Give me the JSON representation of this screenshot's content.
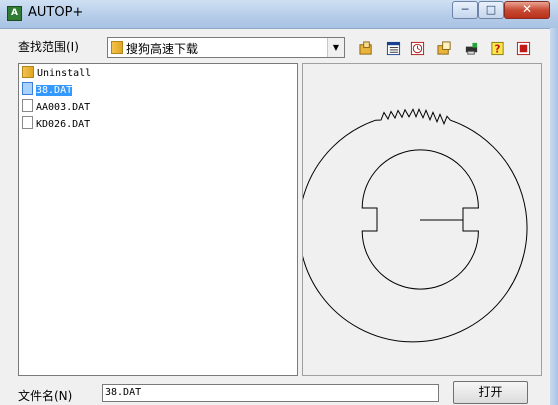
{
  "window": {
    "title": "AUTOP+",
    "app_icon": "app-icon",
    "min_label": "─",
    "max_label": "□",
    "close_label": "✕"
  },
  "look_in": {
    "label": "查找范围(I)",
    "value": "搜狗高速下载"
  },
  "toolbar": {
    "icons": [
      "folder-up-icon",
      "details-view-icon",
      "clock-icon",
      "new-folder-icon",
      "printer-icon",
      "help-icon",
      "note-icon"
    ]
  },
  "files": [
    {
      "name": "Uninstall",
      "type": "folder",
      "selected": false
    },
    {
      "name": "38.DAT",
      "type": "file",
      "selected": true
    },
    {
      "name": "AA003.DAT",
      "type": "file",
      "selected": false
    },
    {
      "name": "KD026.DAT",
      "type": "file",
      "selected": false
    }
  ],
  "filename": {
    "label": "文件名(N)",
    "value": "38.DAT"
  },
  "open_button": "打开",
  "colors": {
    "selection": "#3399ff",
    "close_button": "#c84a33",
    "titlebar": "#b6cde9"
  }
}
